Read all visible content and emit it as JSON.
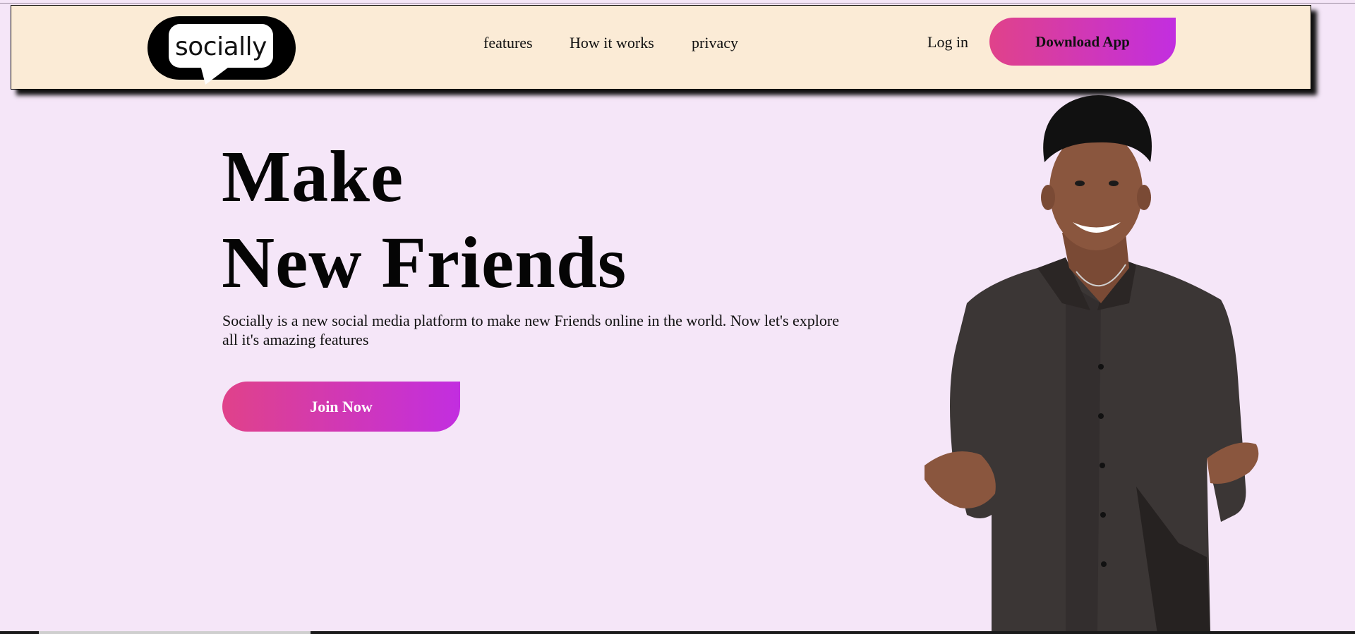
{
  "brand": {
    "logo_text": "socially",
    "accent_gradient": [
      "#e0428a",
      "#c22ee0"
    ],
    "nav_background": "#fbebd6",
    "page_background": "#f5e6f8"
  },
  "nav": {
    "links": [
      {
        "label": "features"
      },
      {
        "label": "How it works"
      },
      {
        "label": "privacy"
      }
    ],
    "login_label": "Log in",
    "download_label": "Download App"
  },
  "hero": {
    "title_line1": "Make",
    "title_line2": "New Friends",
    "description": "Socially is a new social media platform to make new Friends online in the world. Now let's explore all it's amazing features",
    "cta_label": "Join Now",
    "image_subject": "smiling-man-in-dark-shirt"
  }
}
